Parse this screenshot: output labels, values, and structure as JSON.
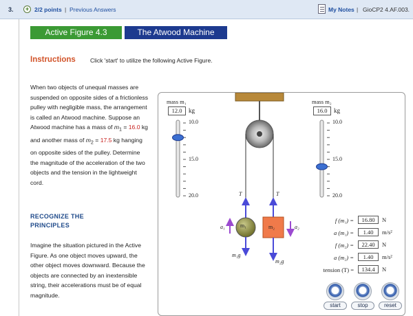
{
  "header": {
    "question_number": "3.",
    "points": "2/2 points",
    "separator": "|",
    "previous_answers": "Previous Answers",
    "my_notes": "My Notes",
    "question_id": "GioCP2 4.AF.003."
  },
  "tabs": {
    "figure": "Active Figure 4.3",
    "title": "The Atwood Machine"
  },
  "instructions": {
    "heading": "Instructions",
    "text": "Click 'start' to utilize the following Active Figure."
  },
  "description": {
    "part1": "When two objects of unequal masses are suspended on opposite sides of a frictionless pulley with negligible mass, the arrangement is called an Atwood machine. Suppose an Atwood machine has a mass of ",
    "m1_symbol": "m",
    "m1_sub": "1",
    "eq": " = ",
    "m1_value": "16.0",
    "part2": " kg and another mass of ",
    "m2_symbol": "m",
    "m2_sub": "2",
    "eq2": " = ",
    "m2_value": "17.5",
    "part3": " kg hanging on opposite sides of the pulley. Determine the magnitude of the acceleration of the two objects and the tension in the lightweight cord."
  },
  "recognize": {
    "heading": "RECOGNIZE THE PRINCIPLES",
    "text": "Imagine the situation pictured in the Active Figure. As one object moves upward, the other object moves downward. Because the objects are connected by an inextensible string, their accelerations must be of equal magnitude."
  },
  "simulation": {
    "mass1_label": "mass m₁",
    "mass1_value": "12.0",
    "mass2_label": "mass m₂",
    "mass2_value": "16.0",
    "kg": "kg",
    "scale": [
      "10.0",
      "15.0",
      "20.0"
    ],
    "slider1_level": 12.0,
    "slider2_level": 16.0,
    "block1_label": "m₁",
    "block2_label": "m₂",
    "tension_label": "T",
    "a1_label": "a₁",
    "a2_label": "a₂",
    "w1_label": "m₁g",
    "w2_label": "m₂g",
    "readouts": [
      {
        "label": "f (m₁) =",
        "value": "16.80",
        "unit": "N"
      },
      {
        "label": "a (m₁) =",
        "value": "1.40",
        "unit": "m/s²"
      },
      {
        "label": "f (m₂) =",
        "value": "22.40",
        "unit": "N"
      },
      {
        "label": "a (m₂) =",
        "value": "1.40",
        "unit": "m/s²"
      },
      {
        "label": "tension (T) =",
        "value": "134.4",
        "unit": "N"
      }
    ],
    "buttons": {
      "start": "start",
      "stop": "stop",
      "reset": "reset"
    },
    "colors": {
      "ball": "#8a8a3a",
      "block": "#f07a4a",
      "arrow_force": "#4a4ad8",
      "arrow_accel": "#9b4ad0",
      "ceiling": "#b8893a"
    }
  }
}
